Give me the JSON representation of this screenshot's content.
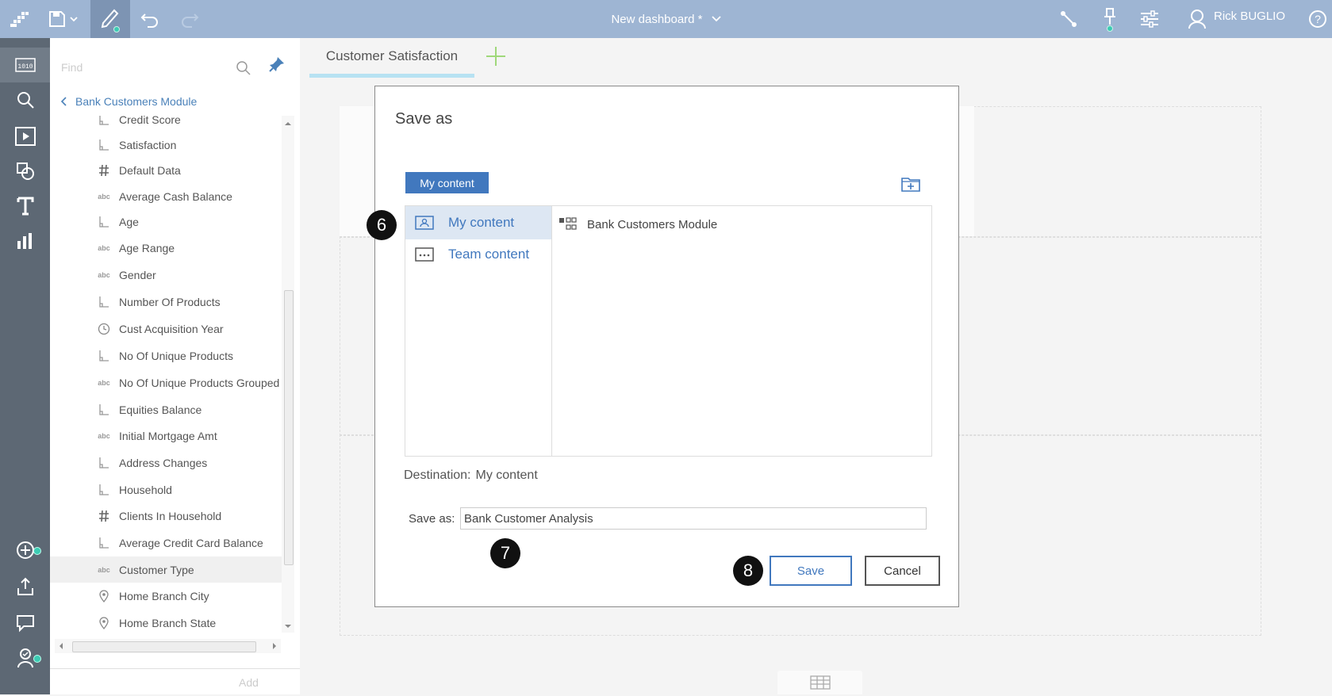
{
  "topbar": {
    "title": "New dashboard *",
    "user": "Rick BUGLIO"
  },
  "panel": {
    "find_placeholder": "Find",
    "back_label": "Bank Customers Module",
    "add_label": "Add",
    "items": [
      {
        "label": "Credit Score",
        "icon": "measure-icon"
      },
      {
        "label": "Satisfaction",
        "icon": "measure-icon"
      },
      {
        "label": "Default Data",
        "icon": "hash-icon"
      },
      {
        "label": "Average Cash Balance",
        "icon": "abc-icon"
      },
      {
        "label": "Age",
        "icon": "measure-icon"
      },
      {
        "label": "Age Range",
        "icon": "abc-icon"
      },
      {
        "label": "Gender",
        "icon": "abc-icon"
      },
      {
        "label": "Number Of Products",
        "icon": "measure-icon"
      },
      {
        "label": "Cust Acquisition Year",
        "icon": "clock-icon"
      },
      {
        "label": "No Of Unique Products",
        "icon": "measure-icon"
      },
      {
        "label": "No Of Unique Products Grouped",
        "icon": "abc-icon"
      },
      {
        "label": "Equities Balance",
        "icon": "measure-icon"
      },
      {
        "label": "Initial Mortgage Amt",
        "icon": "abc-icon"
      },
      {
        "label": "Address Changes",
        "icon": "measure-icon"
      },
      {
        "label": "Household",
        "icon": "measure-icon"
      },
      {
        "label": "Clients In Household",
        "icon": "hash-icon"
      },
      {
        "label": "Average Credit Card Balance",
        "icon": "measure-icon"
      },
      {
        "label": "Customer Type",
        "icon": "abc-icon"
      },
      {
        "label": "Home Branch City",
        "icon": "location-icon"
      },
      {
        "label": "Home Branch State",
        "icon": "location-icon"
      }
    ],
    "abc_text": "abc"
  },
  "canvas": {
    "tab_label": "Customer Satisfaction"
  },
  "dialog": {
    "title": "Save as",
    "crumb": "My content",
    "locations": [
      "My content",
      "Team content"
    ],
    "module": "Bank Customers Module",
    "destination_label": "Destination:",
    "destination_value": "My content",
    "saveas_label": "Save as:",
    "saveas_value": "Bank Customer Analysis",
    "save_button": "Save",
    "cancel_button": "Cancel"
  },
  "steps": [
    "6",
    "7",
    "8"
  ],
  "colors": {
    "topbar": "#9eb5d3",
    "rail": "#5d6874",
    "accent": "#4178be",
    "tab_underline": "#b7e2f2",
    "status_dot": "#3ccbb3"
  }
}
